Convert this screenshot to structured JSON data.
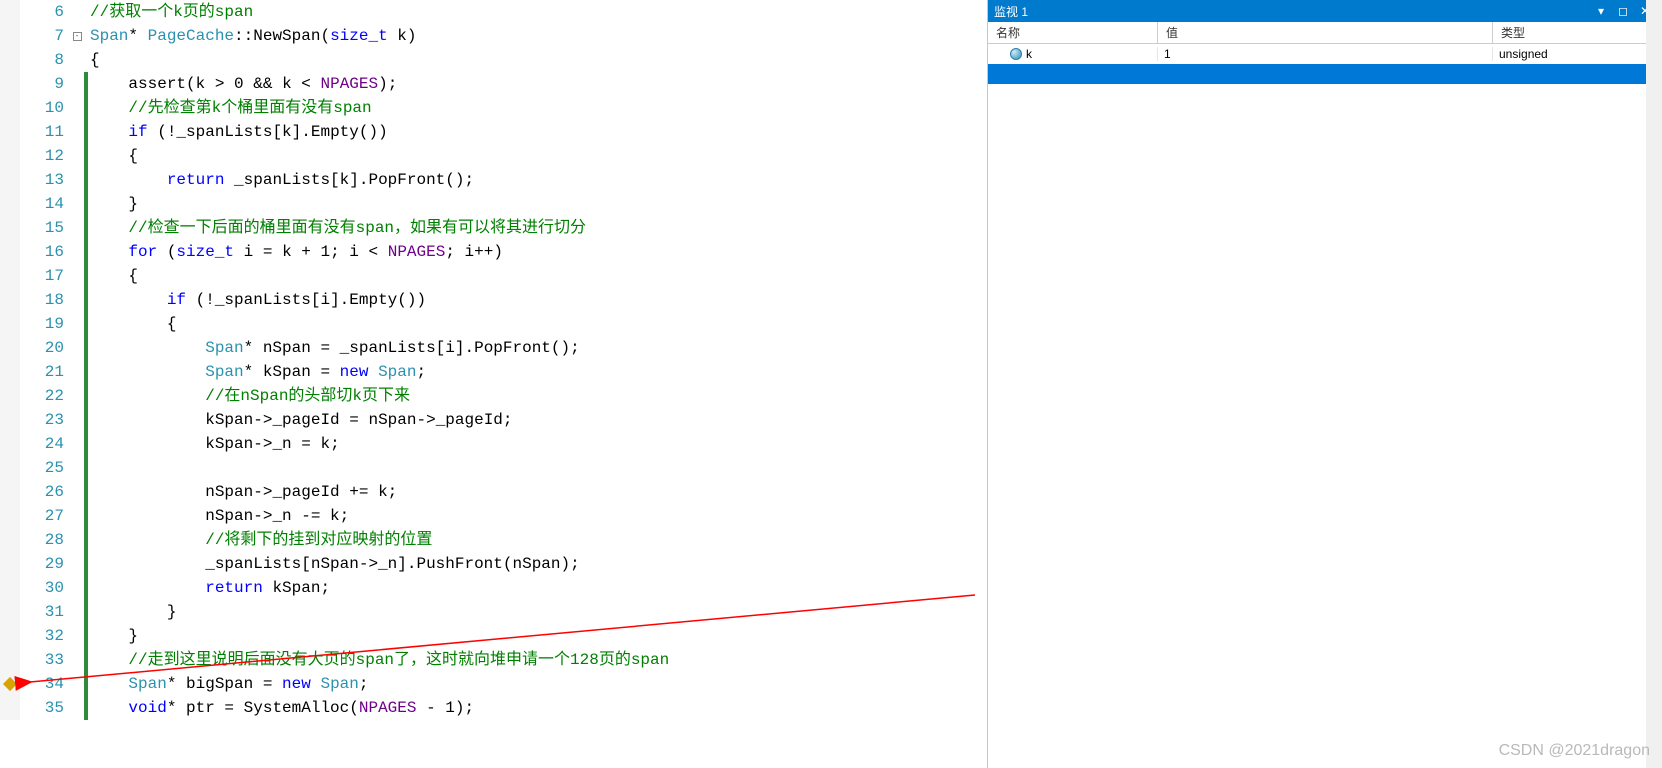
{
  "editor": {
    "breakpoint_line": 34,
    "fold_line": 7,
    "change_marked_lines": [
      9,
      10,
      11,
      12,
      13,
      14,
      15,
      16,
      17,
      18,
      19,
      20,
      21,
      22,
      23,
      24,
      25,
      26,
      27,
      28,
      29,
      30,
      31,
      32,
      33,
      34,
      35
    ],
    "lines": [
      {
        "n": 6,
        "tokens": [
          [
            "comment",
            "//获取一个k页的span"
          ]
        ]
      },
      {
        "n": 7,
        "tokens": [
          [
            "type",
            "Span"
          ],
          [
            "op",
            "* "
          ],
          [
            "type",
            "PageCache"
          ],
          [
            "op",
            "::"
          ],
          [
            "ident",
            "NewSpan"
          ],
          [
            "op",
            "("
          ],
          [
            "keyword",
            "size_t"
          ],
          [
            "op",
            " "
          ],
          [
            "ident",
            "k"
          ],
          [
            "op",
            ")"
          ]
        ]
      },
      {
        "n": 8,
        "tokens": [
          [
            "op",
            "{"
          ]
        ]
      },
      {
        "n": 9,
        "tokens": [
          [
            "op",
            "    "
          ],
          [
            "ident",
            "assert"
          ],
          [
            "op",
            "("
          ],
          [
            "ident",
            "k"
          ],
          [
            "op",
            " > "
          ],
          [
            "num",
            "0"
          ],
          [
            "op",
            " && "
          ],
          [
            "ident",
            "k"
          ],
          [
            "op",
            " < "
          ],
          [
            "macro",
            "NPAGES"
          ],
          [
            "op",
            ");"
          ]
        ]
      },
      {
        "n": 10,
        "tokens": [
          [
            "op",
            "    "
          ],
          [
            "comment",
            "//先检查第k个桶里面有没有span"
          ]
        ]
      },
      {
        "n": 11,
        "tokens": [
          [
            "op",
            "    "
          ],
          [
            "keyword",
            "if"
          ],
          [
            "op",
            " (!"
          ],
          [
            "ident",
            "_spanLists"
          ],
          [
            "op",
            "["
          ],
          [
            "ident",
            "k"
          ],
          [
            "op",
            "]."
          ],
          [
            "ident",
            "Empty"
          ],
          [
            "op",
            "())"
          ]
        ]
      },
      {
        "n": 12,
        "tokens": [
          [
            "op",
            "    {"
          ]
        ]
      },
      {
        "n": 13,
        "tokens": [
          [
            "op",
            "        "
          ],
          [
            "keyword",
            "return"
          ],
          [
            "op",
            " "
          ],
          [
            "ident",
            "_spanLists"
          ],
          [
            "op",
            "["
          ],
          [
            "ident",
            "k"
          ],
          [
            "op",
            "]."
          ],
          [
            "ident",
            "PopFront"
          ],
          [
            "op",
            "();"
          ]
        ]
      },
      {
        "n": 14,
        "tokens": [
          [
            "op",
            "    }"
          ]
        ]
      },
      {
        "n": 15,
        "tokens": [
          [
            "op",
            "    "
          ],
          [
            "comment",
            "//检查一下后面的桶里面有没有span，如果有可以将其进行切分"
          ]
        ]
      },
      {
        "n": 16,
        "tokens": [
          [
            "op",
            "    "
          ],
          [
            "keyword",
            "for"
          ],
          [
            "op",
            " ("
          ],
          [
            "keyword",
            "size_t"
          ],
          [
            "op",
            " "
          ],
          [
            "ident",
            "i"
          ],
          [
            "op",
            " = "
          ],
          [
            "ident",
            "k"
          ],
          [
            "op",
            " + "
          ],
          [
            "num",
            "1"
          ],
          [
            "op",
            "; "
          ],
          [
            "ident",
            "i"
          ],
          [
            "op",
            " < "
          ],
          [
            "macro",
            "NPAGES"
          ],
          [
            "op",
            "; "
          ],
          [
            "ident",
            "i"
          ],
          [
            "op",
            "++)"
          ]
        ]
      },
      {
        "n": 17,
        "tokens": [
          [
            "op",
            "    {"
          ]
        ]
      },
      {
        "n": 18,
        "tokens": [
          [
            "op",
            "        "
          ],
          [
            "keyword",
            "if"
          ],
          [
            "op",
            " (!"
          ],
          [
            "ident",
            "_spanLists"
          ],
          [
            "op",
            "["
          ],
          [
            "ident",
            "i"
          ],
          [
            "op",
            "]."
          ],
          [
            "ident",
            "Empty"
          ],
          [
            "op",
            "())"
          ]
        ]
      },
      {
        "n": 19,
        "tokens": [
          [
            "op",
            "        {"
          ]
        ]
      },
      {
        "n": 20,
        "tokens": [
          [
            "op",
            "            "
          ],
          [
            "type",
            "Span"
          ],
          [
            "op",
            "* "
          ],
          [
            "ident",
            "nSpan"
          ],
          [
            "op",
            " = "
          ],
          [
            "ident",
            "_spanLists"
          ],
          [
            "op",
            "["
          ],
          [
            "ident",
            "i"
          ],
          [
            "op",
            "]."
          ],
          [
            "ident",
            "PopFront"
          ],
          [
            "op",
            "();"
          ]
        ]
      },
      {
        "n": 21,
        "tokens": [
          [
            "op",
            "            "
          ],
          [
            "type",
            "Span"
          ],
          [
            "op",
            "* "
          ],
          [
            "ident",
            "kSpan"
          ],
          [
            "op",
            " = "
          ],
          [
            "keyword",
            "new"
          ],
          [
            "op",
            " "
          ],
          [
            "type",
            "Span"
          ],
          [
            "op",
            ";"
          ]
        ]
      },
      {
        "n": 22,
        "tokens": [
          [
            "op",
            "            "
          ],
          [
            "comment",
            "//在nSpan的头部切k页下来"
          ]
        ]
      },
      {
        "n": 23,
        "tokens": [
          [
            "op",
            "            "
          ],
          [
            "ident",
            "kSpan"
          ],
          [
            "op",
            "->"
          ],
          [
            "ident",
            "_pageId"
          ],
          [
            "op",
            " = "
          ],
          [
            "ident",
            "nSpan"
          ],
          [
            "op",
            "->"
          ],
          [
            "ident",
            "_pageId"
          ],
          [
            "op",
            ";"
          ]
        ]
      },
      {
        "n": 24,
        "tokens": [
          [
            "op",
            "            "
          ],
          [
            "ident",
            "kSpan"
          ],
          [
            "op",
            "->"
          ],
          [
            "ident",
            "_n"
          ],
          [
            "op",
            " = "
          ],
          [
            "ident",
            "k"
          ],
          [
            "op",
            ";"
          ]
        ]
      },
      {
        "n": 25,
        "tokens": []
      },
      {
        "n": 26,
        "tokens": [
          [
            "op",
            "            "
          ],
          [
            "ident",
            "nSpan"
          ],
          [
            "op",
            "->"
          ],
          [
            "ident",
            "_pageId"
          ],
          [
            "op",
            " += "
          ],
          [
            "ident",
            "k"
          ],
          [
            "op",
            ";"
          ]
        ]
      },
      {
        "n": 27,
        "tokens": [
          [
            "op",
            "            "
          ],
          [
            "ident",
            "nSpan"
          ],
          [
            "op",
            "->"
          ],
          [
            "ident",
            "_n"
          ],
          [
            "op",
            " -= "
          ],
          [
            "ident",
            "k"
          ],
          [
            "op",
            ";"
          ]
        ]
      },
      {
        "n": 28,
        "tokens": [
          [
            "op",
            "            "
          ],
          [
            "comment",
            "//将剩下的挂到对应映射的位置"
          ]
        ]
      },
      {
        "n": 29,
        "tokens": [
          [
            "op",
            "            "
          ],
          [
            "ident",
            "_spanLists"
          ],
          [
            "op",
            "["
          ],
          [
            "ident",
            "nSpan"
          ],
          [
            "op",
            "->"
          ],
          [
            "ident",
            "_n"
          ],
          [
            "op",
            "]."
          ],
          [
            "ident",
            "PushFront"
          ],
          [
            "op",
            "("
          ],
          [
            "ident",
            "nSpan"
          ],
          [
            "op",
            ");"
          ]
        ]
      },
      {
        "n": 30,
        "tokens": [
          [
            "op",
            "            "
          ],
          [
            "keyword",
            "return"
          ],
          [
            "op",
            " "
          ],
          [
            "ident",
            "kSpan"
          ],
          [
            "op",
            ";"
          ]
        ]
      },
      {
        "n": 31,
        "tokens": [
          [
            "op",
            "        }"
          ]
        ]
      },
      {
        "n": 32,
        "tokens": [
          [
            "op",
            "    }"
          ]
        ]
      },
      {
        "n": 33,
        "tokens": [
          [
            "op",
            "    "
          ],
          [
            "comment",
            "//走到这里说明后面没有大页的span了，这时就向堆申请一个128页的span"
          ]
        ]
      },
      {
        "n": 34,
        "tokens": [
          [
            "op",
            "    "
          ],
          [
            "type",
            "Span"
          ],
          [
            "op",
            "* "
          ],
          [
            "ident",
            "bigSpan"
          ],
          [
            "op",
            " = "
          ],
          [
            "keyword",
            "new"
          ],
          [
            "op",
            " "
          ],
          [
            "type",
            "Span"
          ],
          [
            "op",
            ";"
          ]
        ]
      },
      {
        "n": 35,
        "tokens": [
          [
            "op",
            "    "
          ],
          [
            "keyword",
            "void"
          ],
          [
            "op",
            "* "
          ],
          [
            "ident",
            "ptr"
          ],
          [
            "op",
            " = "
          ],
          [
            "ident",
            "SystemAlloc"
          ],
          [
            "op",
            "("
          ],
          [
            "macro",
            "NPAGES"
          ],
          [
            "op",
            " - "
          ],
          [
            "num",
            "1"
          ],
          [
            "op",
            ");"
          ]
        ]
      }
    ]
  },
  "watch": {
    "title": "监视 1",
    "buttons": {
      "menu": "▾",
      "dock": "◻",
      "close": "✕"
    },
    "headers": {
      "name": "名称",
      "value": "值",
      "type": "类型"
    },
    "rows": [
      {
        "name": "k",
        "value": "1",
        "type": "unsigned"
      }
    ]
  },
  "watermark": "CSDN @2021dragon"
}
